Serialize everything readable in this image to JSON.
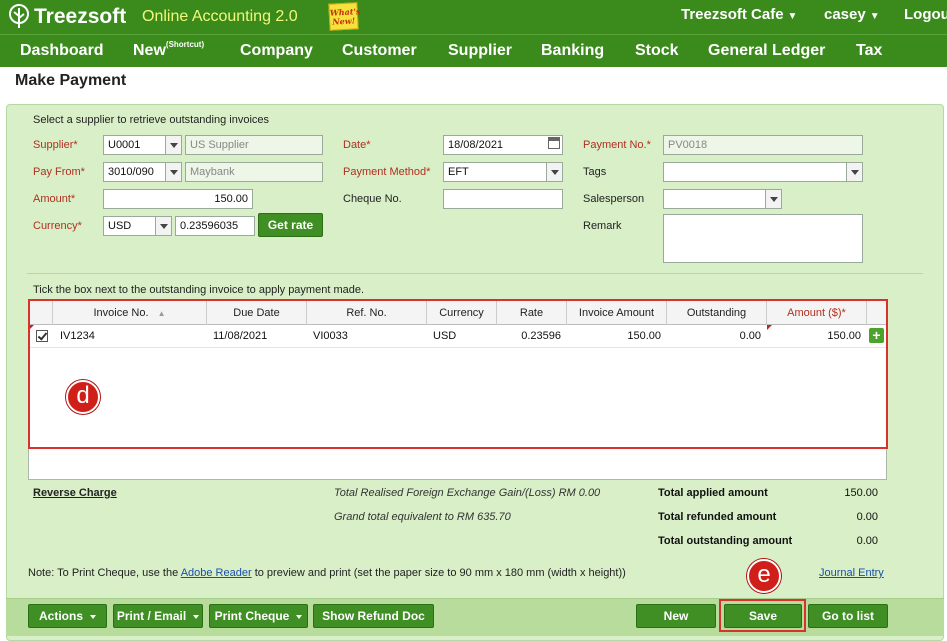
{
  "app": {
    "brand": "Treezsoft",
    "subtitle": "Online Accounting 2.0",
    "whats_new": "What's New!",
    "company": "Treezsoft Cafe",
    "user": "casey",
    "logout": "Logout"
  },
  "nav": {
    "dashboard": "Dashboard",
    "new": "New",
    "new_sup": "(Shortcut)",
    "company": "Company",
    "customer": "Customer",
    "supplier": "Supplier",
    "banking": "Banking",
    "stock": "Stock",
    "general_ledger": "General Ledger",
    "tax": "Tax"
  },
  "page_title": "Make Payment",
  "form": {
    "hint": "Select a supplier to retrieve outstanding invoices",
    "supplier_label": "Supplier*",
    "supplier_code": "U0001",
    "supplier_name": "US Supplier",
    "pay_from_label": "Pay From*",
    "pay_from_code": "3010/090",
    "pay_from_name": "Maybank",
    "amount_label": "Amount*",
    "amount": "150.00",
    "currency_label": "Currency*",
    "currency": "USD",
    "rate": "0.23596035",
    "get_rate": "Get rate",
    "date_label": "Date*",
    "date": "18/08/2021",
    "payment_method_label": "Payment Method*",
    "payment_method": "EFT",
    "cheque_label": "Cheque No.",
    "cheque_no": "",
    "payment_no_label": "Payment No.*",
    "payment_no": "PV0018",
    "tags_label": "Tags",
    "tags": "",
    "salesperson_label": "Salesperson",
    "salesperson": "",
    "remark_label": "Remark",
    "remark": ""
  },
  "grid": {
    "hint": "Tick the box next to the outstanding invoice to apply payment made.",
    "headers": {
      "invoice_no": "Invoice No.",
      "due_date": "Due Date",
      "ref_no": "Ref. No.",
      "currency": "Currency",
      "rate": "Rate",
      "invoice_amount": "Invoice Amount",
      "outstanding": "Outstanding",
      "amount": "Amount ($)*"
    },
    "rows": [
      {
        "invoice_no": "IV1234",
        "due_date": "11/08/2021",
        "ref_no": "VI0033",
        "currency": "USD",
        "rate": "0.23596",
        "invoice_amount": "150.00",
        "outstanding": "0.00",
        "amount": "150.00",
        "checked": true
      }
    ]
  },
  "markers": {
    "d": "d",
    "e": "e"
  },
  "summary": {
    "reverse_charge": "Reverse Charge",
    "fx_gain": "Total Realised Foreign Exchange Gain/(Loss) RM 0.00",
    "grand_total": "Grand total equivalent to RM 635.70",
    "applied_label": "Total applied amount",
    "applied_value": "150.00",
    "refunded_label": "Total refunded amount",
    "refunded_value": "0.00",
    "outstanding_label": "Total outstanding amount",
    "outstanding_value": "0.00"
  },
  "note": {
    "prefix": "Note: To Print Cheque, use the",
    "link": "Adobe Reader",
    "suffix": "to preview and print (set the paper size to 90 mm x 180 mm (width x height))",
    "journal_entry": "Journal Entry"
  },
  "footer": {
    "actions": "Actions",
    "print_email": "Print / Email",
    "print_cheque": "Print Cheque",
    "show_refund": "Show Refund Doc",
    "new": "New",
    "save": "Save",
    "go_to_list": "Go to list"
  },
  "colors": {
    "brand_green": "#3a8a1c",
    "panel_green": "#d8efc8",
    "highlight_red": "#d8312e"
  }
}
